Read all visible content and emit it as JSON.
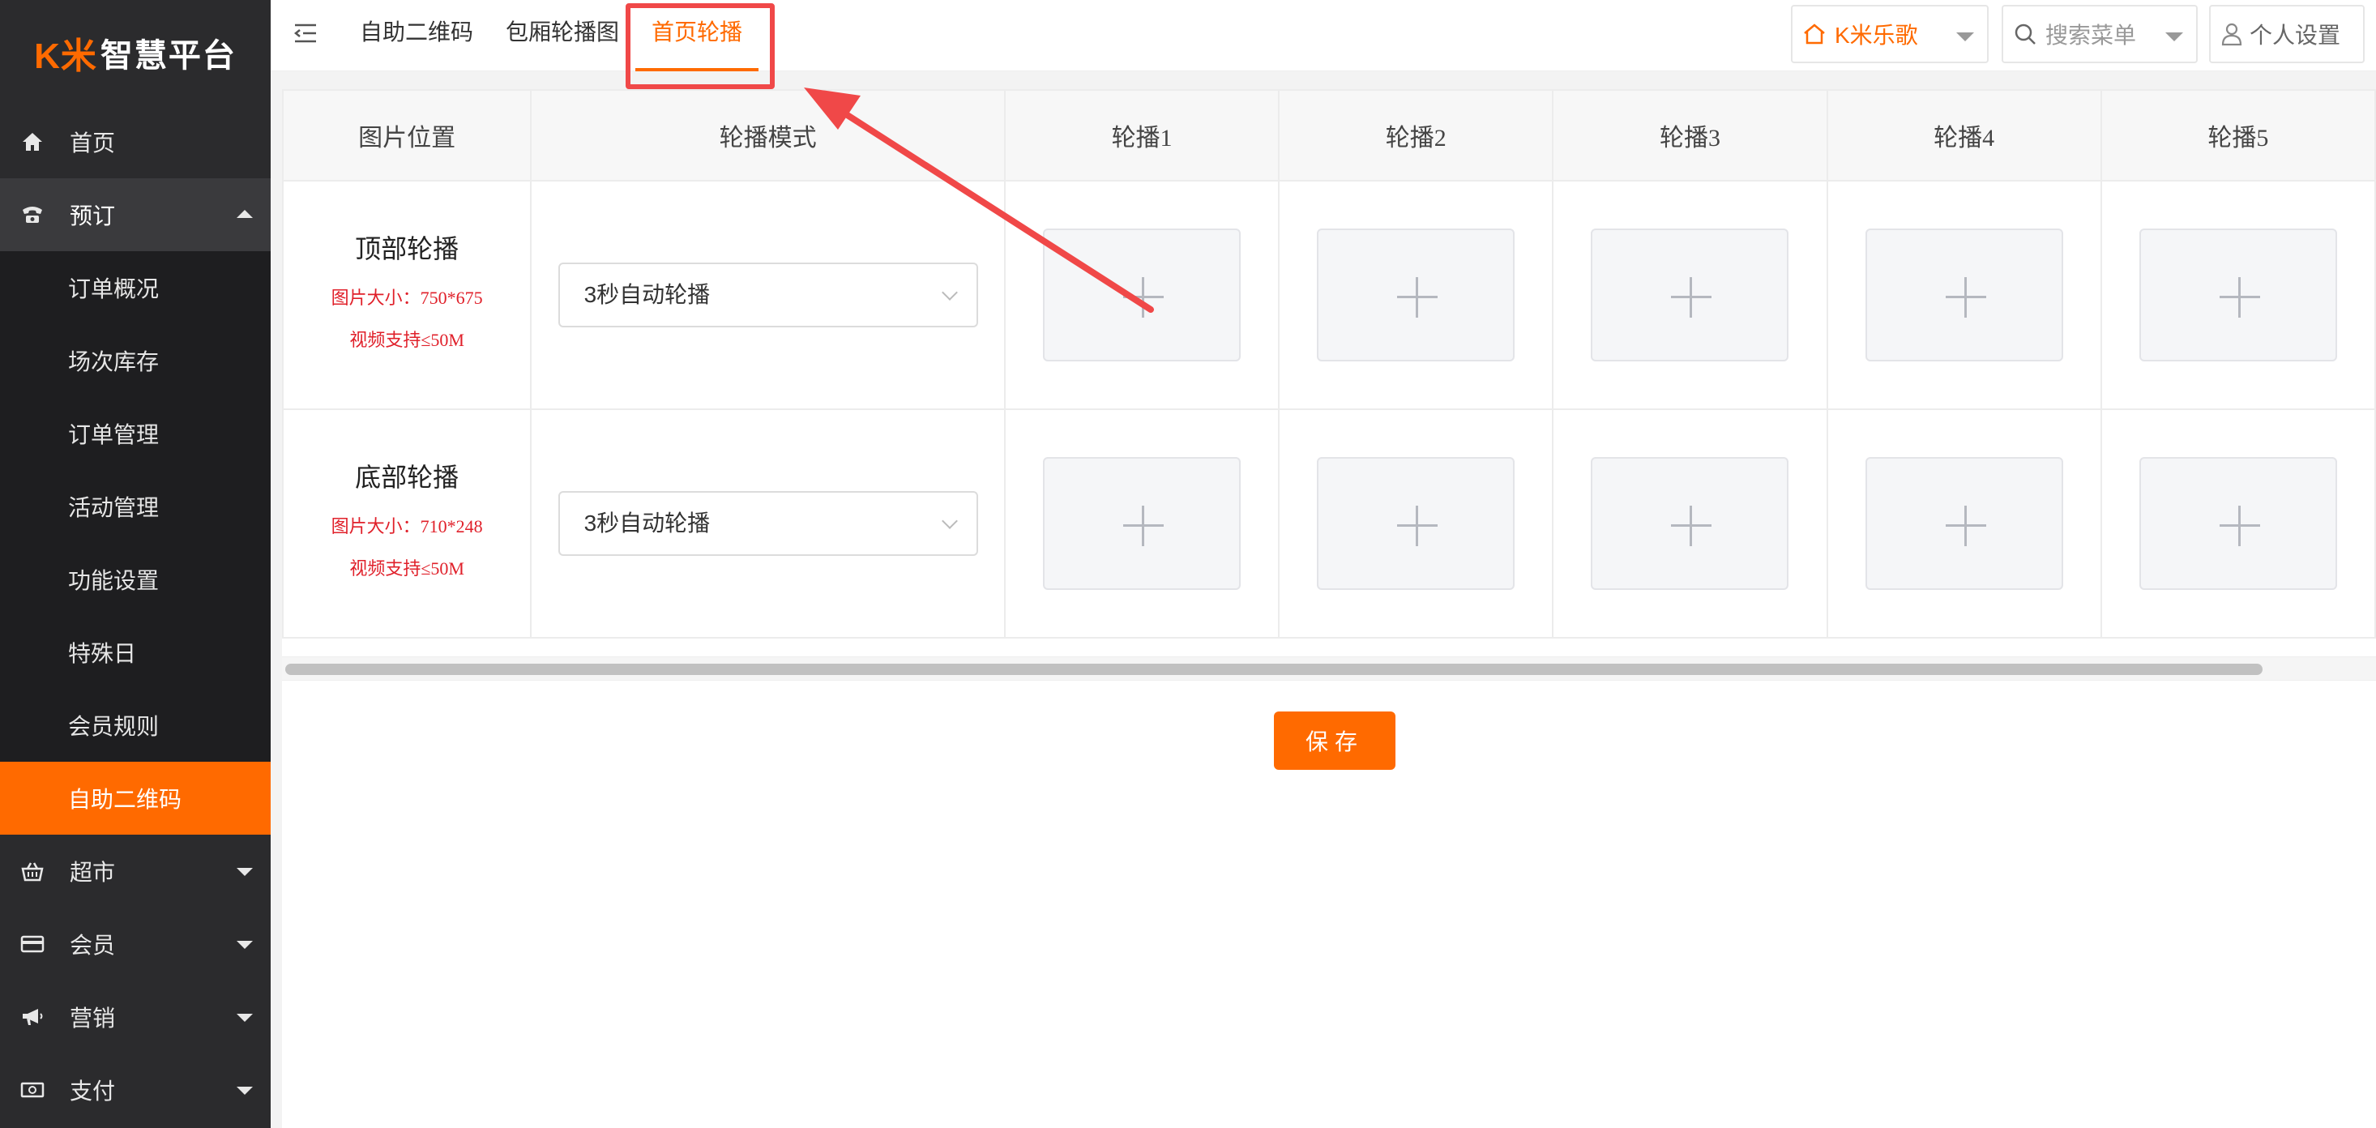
{
  "brand": {
    "logo_k": "K米",
    "logo_text": "智慧平台"
  },
  "sidebar": {
    "top_items": [
      {
        "label": "首页",
        "icon": "home-icon"
      },
      {
        "label": "预订",
        "icon": "phone-icon"
      }
    ],
    "sub_items": [
      "订单概况",
      "场次库存",
      "订单管理",
      "活动管理",
      "功能设置",
      "特殊日",
      "会员规则",
      "自助二维码"
    ],
    "bottom_items": [
      {
        "label": "超市",
        "icon": "basket-icon"
      },
      {
        "label": "会员",
        "icon": "card-icon"
      },
      {
        "label": "营销",
        "icon": "megaphone-icon"
      },
      {
        "label": "支付",
        "icon": "money-icon"
      }
    ]
  },
  "topbar": {
    "tabs": [
      "自助二维码",
      "包厢轮播图",
      "首页轮播"
    ],
    "active_tab": "首页轮播",
    "store": "K米乐歌",
    "search_placeholder": "搜索菜单",
    "settings": "个人设置"
  },
  "table": {
    "headers": [
      "图片位置",
      "轮播模式",
      "轮播1",
      "轮播2",
      "轮播3",
      "轮播4",
      "轮播5"
    ],
    "rows": [
      {
        "position": "顶部轮播",
        "size_note": "图片大小：750*675",
        "video_note": "视频支持≤50M",
        "mode": "3秒自动轮播"
      },
      {
        "position": "底部轮播",
        "size_note": "图片大小：710*248",
        "video_note": "视频支持≤50M",
        "mode": "3秒自动轮播"
      }
    ]
  },
  "actions": {
    "save": "保存"
  },
  "colors": {
    "accent": "#ff6a00",
    "sidebar_bg": "#2b2b2d",
    "annotation": "#f04848",
    "note_red": "#e0202a"
  }
}
